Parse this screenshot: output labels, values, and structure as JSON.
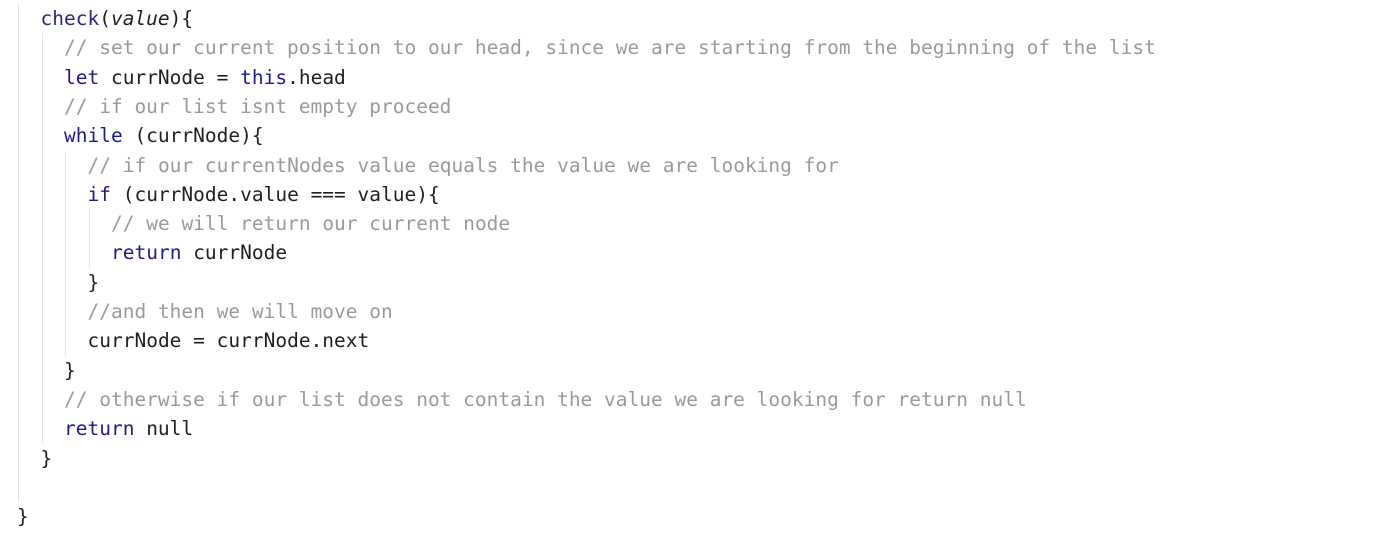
{
  "code": {
    "lines": [
      {
        "indent": 1,
        "tokens": [
          {
            "t": "fn",
            "v": "check"
          },
          {
            "t": "plain",
            "v": "("
          },
          {
            "t": "param",
            "v": "value"
          },
          {
            "t": "plain",
            "v": "){"
          }
        ]
      },
      {
        "indent": 2,
        "tokens": [
          {
            "t": "comment",
            "v": "// set our current position to our head, since we are starting from the beginning of the list"
          }
        ]
      },
      {
        "indent": 2,
        "tokens": [
          {
            "t": "kw",
            "v": "let"
          },
          {
            "t": "plain",
            "v": " currNode = "
          },
          {
            "t": "kw",
            "v": "this"
          },
          {
            "t": "plain",
            "v": ".head"
          }
        ]
      },
      {
        "indent": 2,
        "tokens": [
          {
            "t": "comment",
            "v": "// if our list isnt empty proceed"
          }
        ]
      },
      {
        "indent": 2,
        "tokens": [
          {
            "t": "kw",
            "v": "while"
          },
          {
            "t": "plain",
            "v": " (currNode){"
          }
        ]
      },
      {
        "indent": 3,
        "tokens": [
          {
            "t": "comment",
            "v": "// if our currentNodes value equals the value we are looking for"
          }
        ]
      },
      {
        "indent": 3,
        "tokens": [
          {
            "t": "kw",
            "v": "if"
          },
          {
            "t": "plain",
            "v": " (currNode.value === value){"
          }
        ]
      },
      {
        "indent": 4,
        "tokens": [
          {
            "t": "comment",
            "v": "// we will return our current node"
          }
        ]
      },
      {
        "indent": 4,
        "tokens": [
          {
            "t": "kw",
            "v": "return"
          },
          {
            "t": "plain",
            "v": " currNode"
          }
        ]
      },
      {
        "indent": 3,
        "tokens": [
          {
            "t": "plain",
            "v": "}"
          }
        ]
      },
      {
        "indent": 3,
        "tokens": [
          {
            "t": "comment",
            "v": "//and then we will move on"
          }
        ]
      },
      {
        "indent": 3,
        "tokens": [
          {
            "t": "plain",
            "v": "currNode = currNode.next"
          }
        ]
      },
      {
        "indent": 2,
        "tokens": [
          {
            "t": "plain",
            "v": "}"
          }
        ]
      },
      {
        "indent": 2,
        "tokens": [
          {
            "t": "comment",
            "v": "// otherwise if our list does not contain the value we are looking for return null"
          }
        ]
      },
      {
        "indent": 2,
        "tokens": [
          {
            "t": "kw",
            "v": "return"
          },
          {
            "t": "plain",
            "v": " null"
          }
        ]
      },
      {
        "indent": 1,
        "tokens": [
          {
            "t": "plain",
            "v": "}"
          }
        ]
      },
      {
        "indent": 0,
        "tokens": []
      },
      {
        "indent": 0,
        "tokens": [
          {
            "t": "plain",
            "v": "}"
          }
        ]
      }
    ]
  },
  "colors": {
    "keyword": "#1c1c8a",
    "function": "#2a2a7a",
    "comment": "#9a9a9a",
    "text": "#1f1f1f",
    "indent_guide": "#e3e3e3",
    "background": "#ffffff"
  }
}
